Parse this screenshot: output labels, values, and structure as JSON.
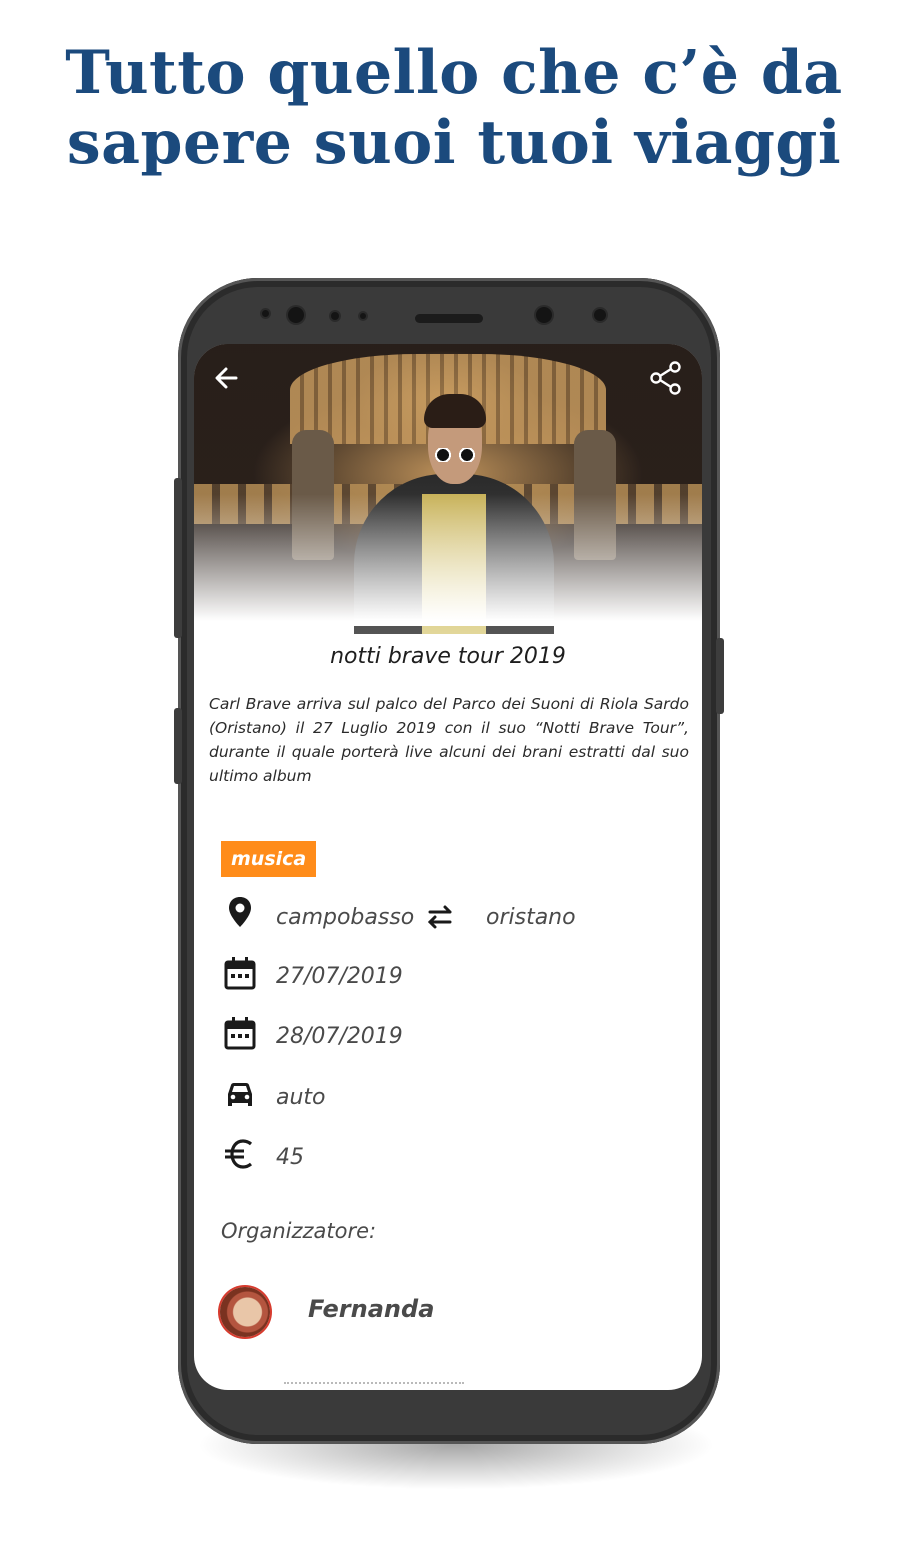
{
  "headline": {
    "line1": "Tutto quello che c’è da",
    "line2": "sapere suoi tuoi viaggi"
  },
  "app_bar": {
    "back_icon": "arrow-back-icon",
    "share_icon": "share-icon"
  },
  "event": {
    "title": "notti brave tour 2019",
    "description": "Carl Brave arriva sul palco del Parco dei Suoni di Riola Sardo (Oristano) il 27 Luglio 2019 con il suo “Notti Brave Tour”, durante il quale porterà live alcuni dei brani estratti dal suo ultimo album",
    "category": "musica",
    "category_color": "#ff8c1a",
    "from": "campobasso",
    "to": "oristano",
    "start_date": "27/07/2019",
    "end_date": "28/07/2019",
    "transport": "auto",
    "price": "45"
  },
  "organizer": {
    "label": "Organizzatore:",
    "name": "Fernanda"
  },
  "colors": {
    "headline": "#1b4a7d",
    "phone_body": "#3a3a3a"
  }
}
